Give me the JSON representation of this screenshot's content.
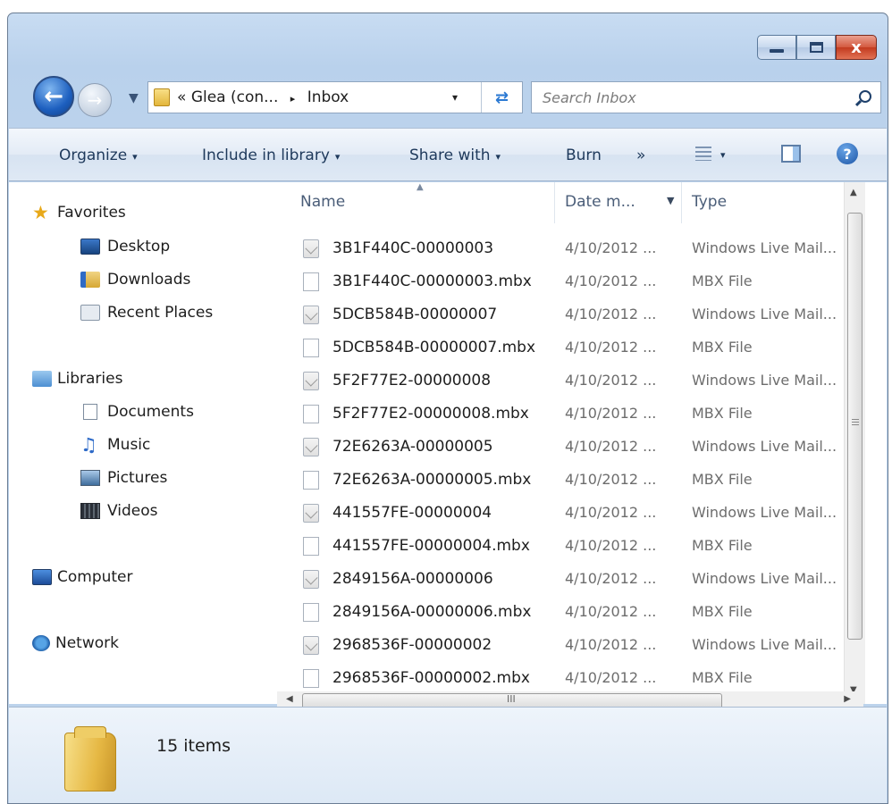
{
  "window": {
    "caption_buttons": [
      "minimize",
      "maximize",
      "close"
    ],
    "close_glyph": "x"
  },
  "address": {
    "prefix": "«",
    "crumb": "Glea (con...",
    "separator": "▸",
    "current": "Inbox",
    "dropdown_arrow": "▾"
  },
  "search": {
    "placeholder": "Search Inbox"
  },
  "command_bar": {
    "organize": "Organize",
    "include_in_library": "Include in library",
    "share_with": "Share with",
    "burn": "Burn",
    "more": "»",
    "arrow": "▾"
  },
  "nav_pane": {
    "favorites": "Favorites",
    "desktop": "Desktop",
    "downloads": "Downloads",
    "recent_places": "Recent Places",
    "libraries": "Libraries",
    "documents": "Documents",
    "music": "Music",
    "pictures": "Pictures",
    "videos": "Videos",
    "computer": "Computer",
    "network": "Network"
  },
  "columns": {
    "name": "Name",
    "date": "Date m...",
    "type": "Type"
  },
  "files": [
    {
      "name": "3B1F440C-00000003",
      "date": "4/10/2012 ...",
      "type": "Windows Live Mail...",
      "icon": "mail-icon"
    },
    {
      "name": "3B1F440C-00000003.mbx",
      "date": "4/10/2012 ...",
      "type": "MBX File",
      "icon": "file-icon"
    },
    {
      "name": "5DCB584B-00000007",
      "date": "4/10/2012 ...",
      "type": "Windows Live Mail...",
      "icon": "mail-icon"
    },
    {
      "name": "5DCB584B-00000007.mbx",
      "date": "4/10/2012 ...",
      "type": "MBX File",
      "icon": "file-icon"
    },
    {
      "name": "5F2F77E2-00000008",
      "date": "4/10/2012 ...",
      "type": "Windows Live Mail...",
      "icon": "mail-icon"
    },
    {
      "name": "5F2F77E2-00000008.mbx",
      "date": "4/10/2012 ...",
      "type": "MBX File",
      "icon": "file-icon"
    },
    {
      "name": "72E6263A-00000005",
      "date": "4/10/2012 ...",
      "type": "Windows Live Mail...",
      "icon": "mail-icon"
    },
    {
      "name": "72E6263A-00000005.mbx",
      "date": "4/10/2012 ...",
      "type": "MBX File",
      "icon": "file-icon"
    },
    {
      "name": "441557FE-00000004",
      "date": "4/10/2012 ...",
      "type": "Windows Live Mail...",
      "icon": "mail-icon"
    },
    {
      "name": "441557FE-00000004.mbx",
      "date": "4/10/2012 ...",
      "type": "MBX File",
      "icon": "file-icon"
    },
    {
      "name": "2849156A-00000006",
      "date": "4/10/2012 ...",
      "type": "Windows Live Mail...",
      "icon": "mail-icon"
    },
    {
      "name": "2849156A-00000006.mbx",
      "date": "4/10/2012 ...",
      "type": "MBX File",
      "icon": "file-icon"
    },
    {
      "name": "2968536F-00000002",
      "date": "4/10/2012 ...",
      "type": "Windows Live Mail...",
      "icon": "mail-icon"
    },
    {
      "name": "2968536F-00000002.mbx",
      "date": "4/10/2012 ...",
      "type": "MBX File",
      "icon": "file-icon"
    }
  ],
  "scroll_grip_glyph": "III",
  "details": {
    "item_count": "15 items"
  },
  "colors": {
    "frame": "#b9d1ec",
    "close_button": "#c23a1f",
    "secondary_text": "#6d6d6d"
  }
}
